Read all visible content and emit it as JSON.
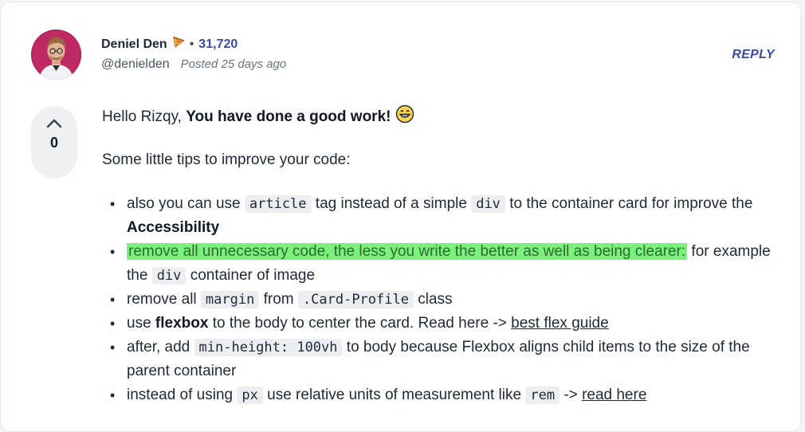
{
  "comment": {
    "author": {
      "name": "Deniel Den",
      "separator": "•",
      "score": "31,720",
      "handle": "@denielden",
      "posted": "Posted 25 days ago",
      "avatar_icon": "user-avatar",
      "badge_icon": "pizza-icon"
    },
    "reply_label": "REPLY",
    "votes": {
      "count": "0",
      "up_icon": "chevron-up-icon"
    },
    "body": {
      "greeting_prefix": "Hello Rizqy, ",
      "greeting_bold": "You have done a good work!",
      "greeting_emoji": "grinning-face-icon",
      "tips_intro": "Some little tips to improve your code:",
      "tips": [
        {
          "t1": "also you can use ",
          "c1": "article",
          "t2": " tag instead of a simple ",
          "c2": "div",
          "t3": " to the container card for improve the ",
          "b1": "Accessibility"
        },
        {
          "highlight": "remove all unnecessary code, the less you write the better as well as being clearer:",
          "t1": " for example the ",
          "c1": "div",
          "t2": " container of image"
        },
        {
          "t1": "remove all ",
          "c1": "margin",
          "t2": " from ",
          "c2": ".Card-Profile",
          "t3": " class"
        },
        {
          "t1": "use ",
          "b1": "flexbox",
          "t2": " to the body to center the card. Read here -> ",
          "link": "best flex guide"
        },
        {
          "t1": "after, add ",
          "c1": "min-height: 100vh",
          "t2": " to body because Flexbox aligns child items to the size of the parent container"
        },
        {
          "t1": "instead of using ",
          "c1": "px",
          "t2": " use relative units of measurement like ",
          "c2": "rem",
          "t3": " -> ",
          "link": "read here"
        }
      ]
    }
  },
  "colors": {
    "accent": "#3b4aa0",
    "highlight": "#7cf07c",
    "code_bg": "#eceef1",
    "vote_bg": "#eef0f2",
    "page_bg": "#f3f4f6"
  }
}
